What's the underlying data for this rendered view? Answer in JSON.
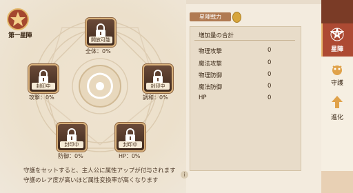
{
  "badge": {
    "label": "第一星陣"
  },
  "nodes": [
    {
      "id": "top",
      "status": "開放可能",
      "stat": "全体：0%"
    },
    {
      "id": "left",
      "status": "封印中",
      "stat": "攻撃：0%"
    },
    {
      "id": "right",
      "status": "封印中",
      "stat": "調和：0%"
    },
    {
      "id": "bottom-left",
      "status": "封印中",
      "stat": "防御：0%"
    },
    {
      "id": "bottom-right",
      "status": "封印中",
      "stat": "HP：0%"
    }
  ],
  "hints": [
    "守護をセットすると、主人公に属性アップが付与されます",
    "守護のレア度が高いほど属性変換率が高くなります"
  ],
  "panel": {
    "header": "星陣戦力",
    "title": "増加量の合計",
    "stats": [
      {
        "name": "物理攻撃",
        "value": "0"
      },
      {
        "name": "魔法攻撃",
        "value": "0"
      },
      {
        "name": "物理防御",
        "value": "0"
      },
      {
        "name": "魔法防御",
        "value": "0"
      },
      {
        "name": "HP",
        "value": "0"
      }
    ]
  },
  "rail": {
    "tabs": [
      {
        "label": "星陣",
        "active": true
      },
      {
        "label": "守護",
        "active": false
      },
      {
        "label": "進化",
        "active": false
      }
    ]
  },
  "colors": {
    "accent": "#ad4a33",
    "node_bg": "#4e3426",
    "gold": "#d8b07a"
  }
}
